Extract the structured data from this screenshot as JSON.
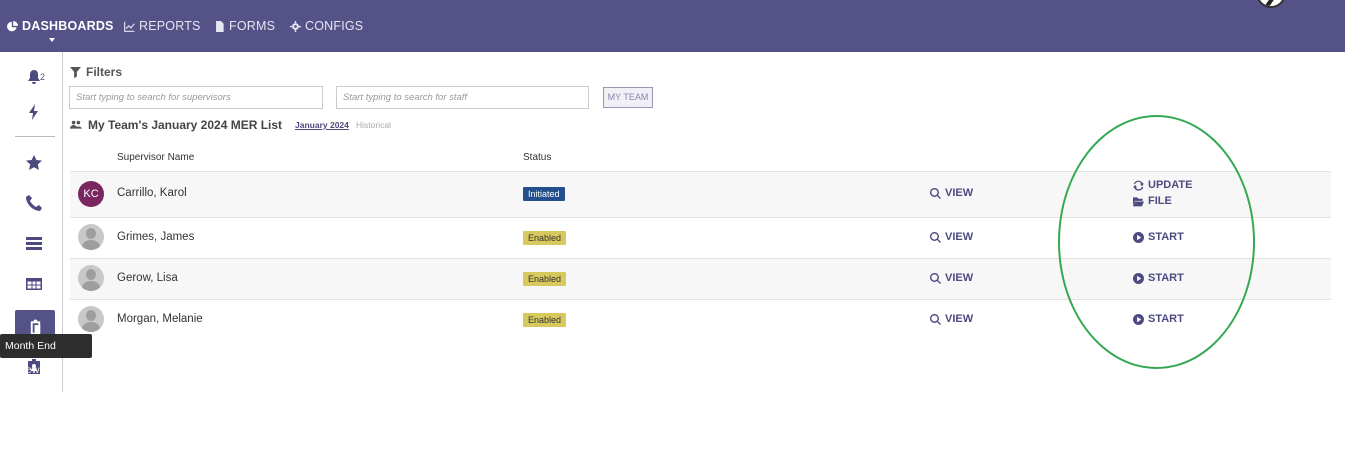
{
  "nav": {
    "items": [
      {
        "label": "DASHBOARDS",
        "icon": "pie-chart-icon",
        "active": true
      },
      {
        "label": "REPORTS",
        "icon": "line-chart-icon",
        "active": false
      },
      {
        "label": "FORMS",
        "icon": "file-icon",
        "active": false
      },
      {
        "label": "CONFIGS",
        "icon": "gear-icon",
        "active": false
      }
    ]
  },
  "sidebar": {
    "notification_count": "2",
    "items": [
      {
        "icon": "bell-icon"
      },
      {
        "icon": "bolt-icon"
      },
      {
        "icon": "star-icon"
      },
      {
        "icon": "phone-icon"
      },
      {
        "icon": "server-icon"
      },
      {
        "icon": "table-icon"
      },
      {
        "icon": "clipboard-icon",
        "active": true
      },
      {
        "icon": "id-badge-icon"
      }
    ],
    "tooltip": "Month End Review"
  },
  "filters": {
    "title": "Filters",
    "supervisor_placeholder": "Start typing to search for supervisors",
    "staff_placeholder": "Start typing to search for staff",
    "my_team_label": "MY TEAM"
  },
  "list": {
    "title": "My Team's January 2024 MER List",
    "period_label": "January 2024",
    "historical_label": "Historical",
    "columns": {
      "supervisor": "Supervisor Name",
      "status": "Status"
    },
    "rows": [
      {
        "initials": "KC",
        "name": "Carrillo, Karol",
        "status": "Initiated",
        "view": "VIEW",
        "actions": [
          "UPDATE",
          "FILE"
        ]
      },
      {
        "initials": "",
        "name": "Grimes, James",
        "status": "Enabled",
        "view": "VIEW",
        "actions": [
          "START"
        ]
      },
      {
        "initials": "",
        "name": "Gerow, Lisa",
        "status": "Enabled",
        "view": "VIEW",
        "actions": [
          "START"
        ]
      },
      {
        "initials": "",
        "name": "Morgan, Melanie",
        "status": "Enabled",
        "view": "VIEW",
        "actions": [
          "START"
        ]
      }
    ]
  },
  "colors": {
    "nav_bg": "#545287",
    "accent": "#4d4a80",
    "initiated": "#234f8e",
    "enabled": "#d8c95f",
    "annotation": "#34a853"
  }
}
